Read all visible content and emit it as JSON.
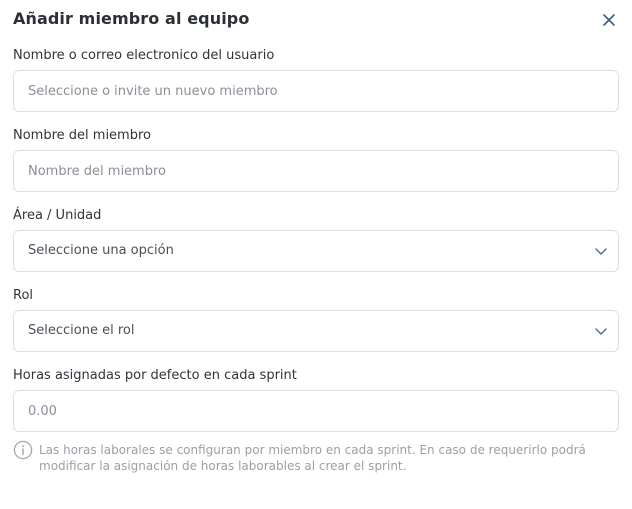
{
  "dialog": {
    "title": "Añadir miembro al equipo",
    "close_icon": "close-icon"
  },
  "fields": {
    "user": {
      "label": "Nombre o correo electronico del usuario",
      "placeholder": "Seleccione o invite un nuevo miembro",
      "value": ""
    },
    "member_name": {
      "label": "Nombre del miembro",
      "placeholder": "Nombre del miembro",
      "value": ""
    },
    "area": {
      "label": "Área / Unidad",
      "selected": "Seleccione una opción",
      "icon": "chevron-down-icon"
    },
    "role": {
      "label": "Rol",
      "selected": "Seleccione el rol",
      "icon": "chevron-down-icon"
    },
    "hours": {
      "label": "Horas asignadas por defecto en cada sprint",
      "placeholder": "0.00",
      "value": ""
    }
  },
  "info": {
    "icon": "info-icon",
    "text": "Las horas laborales se configuran por miembro en cada sprint. En caso de requerirlo podrá modificar la asignación de horas laborables al crear el sprint."
  },
  "colors": {
    "border": "#dcdfe4",
    "title": "#2b2f36",
    "muted": "#9aa0a8"
  }
}
